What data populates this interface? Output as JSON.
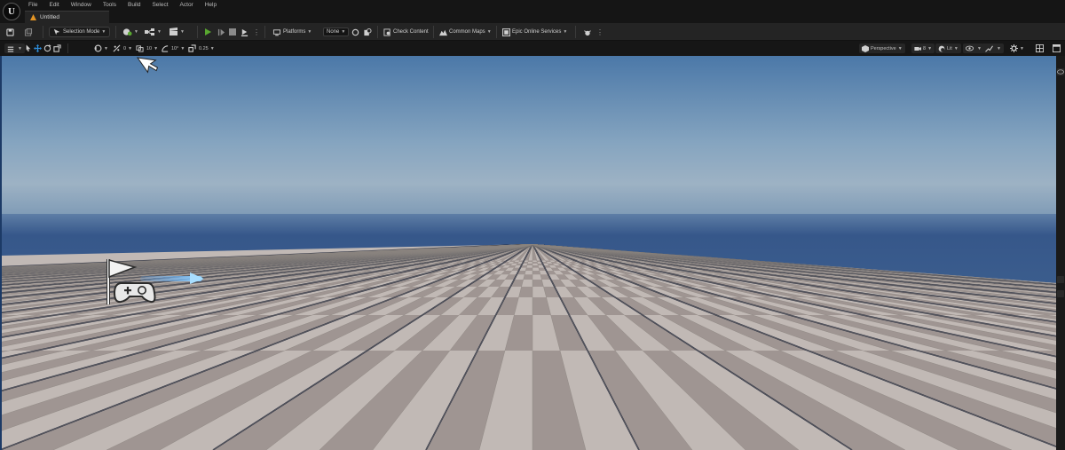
{
  "app": {
    "logo_text": "U",
    "menu": [
      "File",
      "Edit",
      "Window",
      "Tools",
      "Build",
      "Select",
      "Actor",
      "Help"
    ],
    "document_tab": "Untitled"
  },
  "toolbar": {
    "mode_label": "Selection Mode",
    "platforms_label": "Platforms",
    "none_label": "None",
    "check_content_label": "Check Content",
    "common_maps_label": "Common Maps",
    "eos_label": "Epic Online Services",
    "play_color": "#59a830"
  },
  "viewport_toolbar": {
    "translate_snap": "0",
    "rotate_snap_a": "10",
    "rotate_snap_b": "10°",
    "scale_snap": "0.25",
    "view_mode_label": "Perspective",
    "camera_speed": "8",
    "lit_label": "Lit"
  },
  "viewport": {
    "sky_top_color": "#4b78a8",
    "sky_horizon_color": "#9db2c4",
    "ocean_color": "#36578a",
    "floor_light_color": "#c1b9b5",
    "floor_dark_color": "#9f9592",
    "player_start_icon": "player-start-flag-gamepad-icon",
    "cursor_icon": "arrow-cursor-icon"
  }
}
